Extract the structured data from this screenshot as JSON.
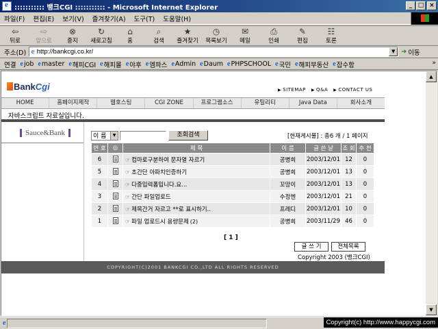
{
  "window": {
    "title": "::::::::::: 뱅크CGI ::::::::::: - Microsoft Internet Explorer",
    "min_label": "_",
    "max_label": "□",
    "close_label": "×"
  },
  "menubar": [
    "파일(F)",
    "편집(E)",
    "보기(V)",
    "즐겨찾기(A)",
    "도구(T)",
    "도움말(H)"
  ],
  "toolbar": [
    {
      "label": "뒤로",
      "icon": "back-arrow-icon",
      "glyph": "⇦",
      "disabled": false
    },
    {
      "label": "앞으로",
      "icon": "forward-arrow-icon",
      "glyph": "⇨",
      "disabled": true
    },
    {
      "label": "중지",
      "icon": "stop-icon",
      "glyph": "⊗",
      "disabled": false
    },
    {
      "label": "새로고침",
      "icon": "refresh-icon",
      "glyph": "↻",
      "disabled": false
    },
    {
      "label": "홈",
      "icon": "home-icon",
      "glyph": "⌂",
      "disabled": false
    },
    {
      "label": "검색",
      "icon": "search-icon",
      "glyph": "⌕",
      "disabled": false
    },
    {
      "label": "즐겨찾기",
      "icon": "favorites-icon",
      "glyph": "★",
      "disabled": false
    },
    {
      "label": "목록보기",
      "icon": "history-icon",
      "glyph": "◷",
      "disabled": false
    },
    {
      "label": "메일",
      "icon": "mail-icon",
      "glyph": "✉",
      "disabled": false
    },
    {
      "label": "인쇄",
      "icon": "print-icon",
      "glyph": "⎙",
      "disabled": false
    },
    {
      "label": "편집",
      "icon": "edit-icon",
      "glyph": "✎",
      "disabled": false
    },
    {
      "label": "토론",
      "icon": "discuss-icon",
      "glyph": "☷",
      "disabled": false
    }
  ],
  "address": {
    "label": "주소(D)",
    "url": "http://bankcgi.co.kr/",
    "go_label": "이동"
  },
  "links": {
    "label": "연결",
    "items": [
      "job",
      "master",
      "해피CGI",
      "해피몰",
      "야후",
      "엠파스",
      "Admin",
      "Daum",
      "PHPSCHOOL",
      "국민",
      "해피부동산",
      "잡수함"
    ],
    "more": "»"
  },
  "site": {
    "logo_a": "Bank",
    "logo_b": "Cgi",
    "toplinks": [
      "SITEMAP",
      "Q&A",
      "CONTACT US"
    ],
    "nav": [
      "HOME",
      "홈페이지제작",
      "웹호스팅",
      "CGI ZONE",
      "프로그램소스",
      "유틸리티",
      "Java Data",
      "회사소개"
    ],
    "subtitle": "자바스크립트 자료실입니다.",
    "sidebar_title": "Sauce&Bank",
    "search": {
      "select_value": "이 름",
      "button_label": "조회검색"
    },
    "count_info": "[현재게시물] : 총6 개 / 1 페이지",
    "table": {
      "headers": [
        "번 호",
        "◎",
        "제     목",
        "이 름",
        "글 쓴 날",
        "조 회",
        "추 천"
      ],
      "rows": [
        {
          "no": "6",
          "title": "컴마로구분하여 문자열 자르기",
          "comments": "",
          "author": "공병희",
          "date": "2003/12/01",
          "views": "12",
          "rec": "0"
        },
        {
          "no": "5",
          "title": "초간단 아파치인증하기",
          "comments": "",
          "author": "공병희",
          "date": "2003/12/01",
          "views": "13",
          "rec": "0"
        },
        {
          "no": "4",
          "title": "다중입력폼입니다.요...",
          "comments": "",
          "author": "꼬망이",
          "date": "2003/12/01",
          "views": "13",
          "rec": "0"
        },
        {
          "no": "3",
          "title": "간단 파일업로드",
          "comments": "",
          "author": "수정헨",
          "date": "2003/12/01",
          "views": "21",
          "rec": "0"
        },
        {
          "no": "2",
          "title": "제목간거 자르고 **로 표시하기..",
          "comments": "",
          "author": "프레디",
          "date": "2003/12/01",
          "views": "10",
          "rec": "0"
        },
        {
          "no": "1",
          "title": "파일 업로드시 용량문제",
          "comments": "(2)",
          "author": "공병희",
          "date": "2003/11/29",
          "views": "46",
          "rec": "0"
        }
      ]
    },
    "pager": "[ 1 ]",
    "write_button": "글 쓰 기",
    "list_button": "전체목록",
    "copyright": "Copyright 2003 (뱅크CGI)",
    "footer": "COPYRIGHT(C)2001 BANKCGI CO.,LTD ALL RIGHTS RESERVED"
  },
  "overlay": "Copyright(c) http://www.happycgi.com"
}
